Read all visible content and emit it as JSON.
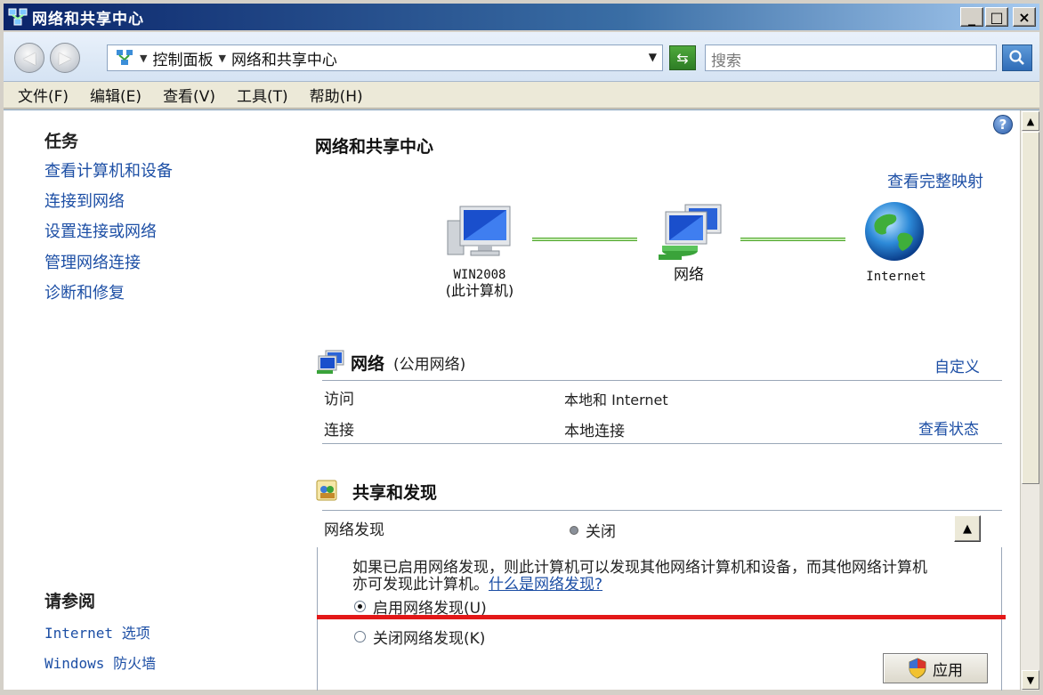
{
  "window": {
    "title": "网络和共享中心",
    "min_label": "_",
    "max_label": "□",
    "close_label": "×"
  },
  "address": {
    "path": [
      "控制面板",
      "网络和共享中心"
    ],
    "search_placeholder": "搜索"
  },
  "menu": [
    "文件(F)",
    "编辑(E)",
    "查看(V)",
    "工具(T)",
    "帮助(H)"
  ],
  "sidebar": {
    "tasks_header": "任务",
    "tasks": [
      "查看计算机和设备",
      "连接到网络",
      "设置连接或网络",
      "管理网络连接",
      "诊断和修复"
    ],
    "see_also_header": "请参阅",
    "see_also": [
      "Internet 选项",
      "Windows 防火墙"
    ]
  },
  "main": {
    "title": "网络和共享中心",
    "full_map_link": "查看完整映射",
    "nodes": {
      "computer_name": "WIN2008",
      "computer_sub": "(此计算机)",
      "network": "网络",
      "internet": "Internet"
    },
    "network_section": {
      "title": "网络",
      "subtitle": "(公用网络)",
      "customize": "自定义",
      "rows": [
        {
          "label": "访问",
          "value": "本地和 Internet",
          "action": ""
        },
        {
          "label": "连接",
          "value": "本地连接",
          "action": "查看状态"
        }
      ]
    },
    "sharing_section": {
      "title": "共享和发现",
      "discovery_label": "网络发现",
      "discovery_state": "关闭",
      "description_line1": "如果已启用网络发现，则此计算机可以发现其他网络计算机和设备，而其他网络计算机",
      "description_line2": "亦可发现此计算机。",
      "what_is_link": "什么是网络发现?",
      "option_on": "启用网络发现(U)",
      "option_off": "关闭网络发现(K)",
      "apply_button": "应用"
    }
  },
  "colors": {
    "link": "#1d4fa5",
    "highlight_line": "#e31818",
    "network_line": "#4ea62b"
  }
}
